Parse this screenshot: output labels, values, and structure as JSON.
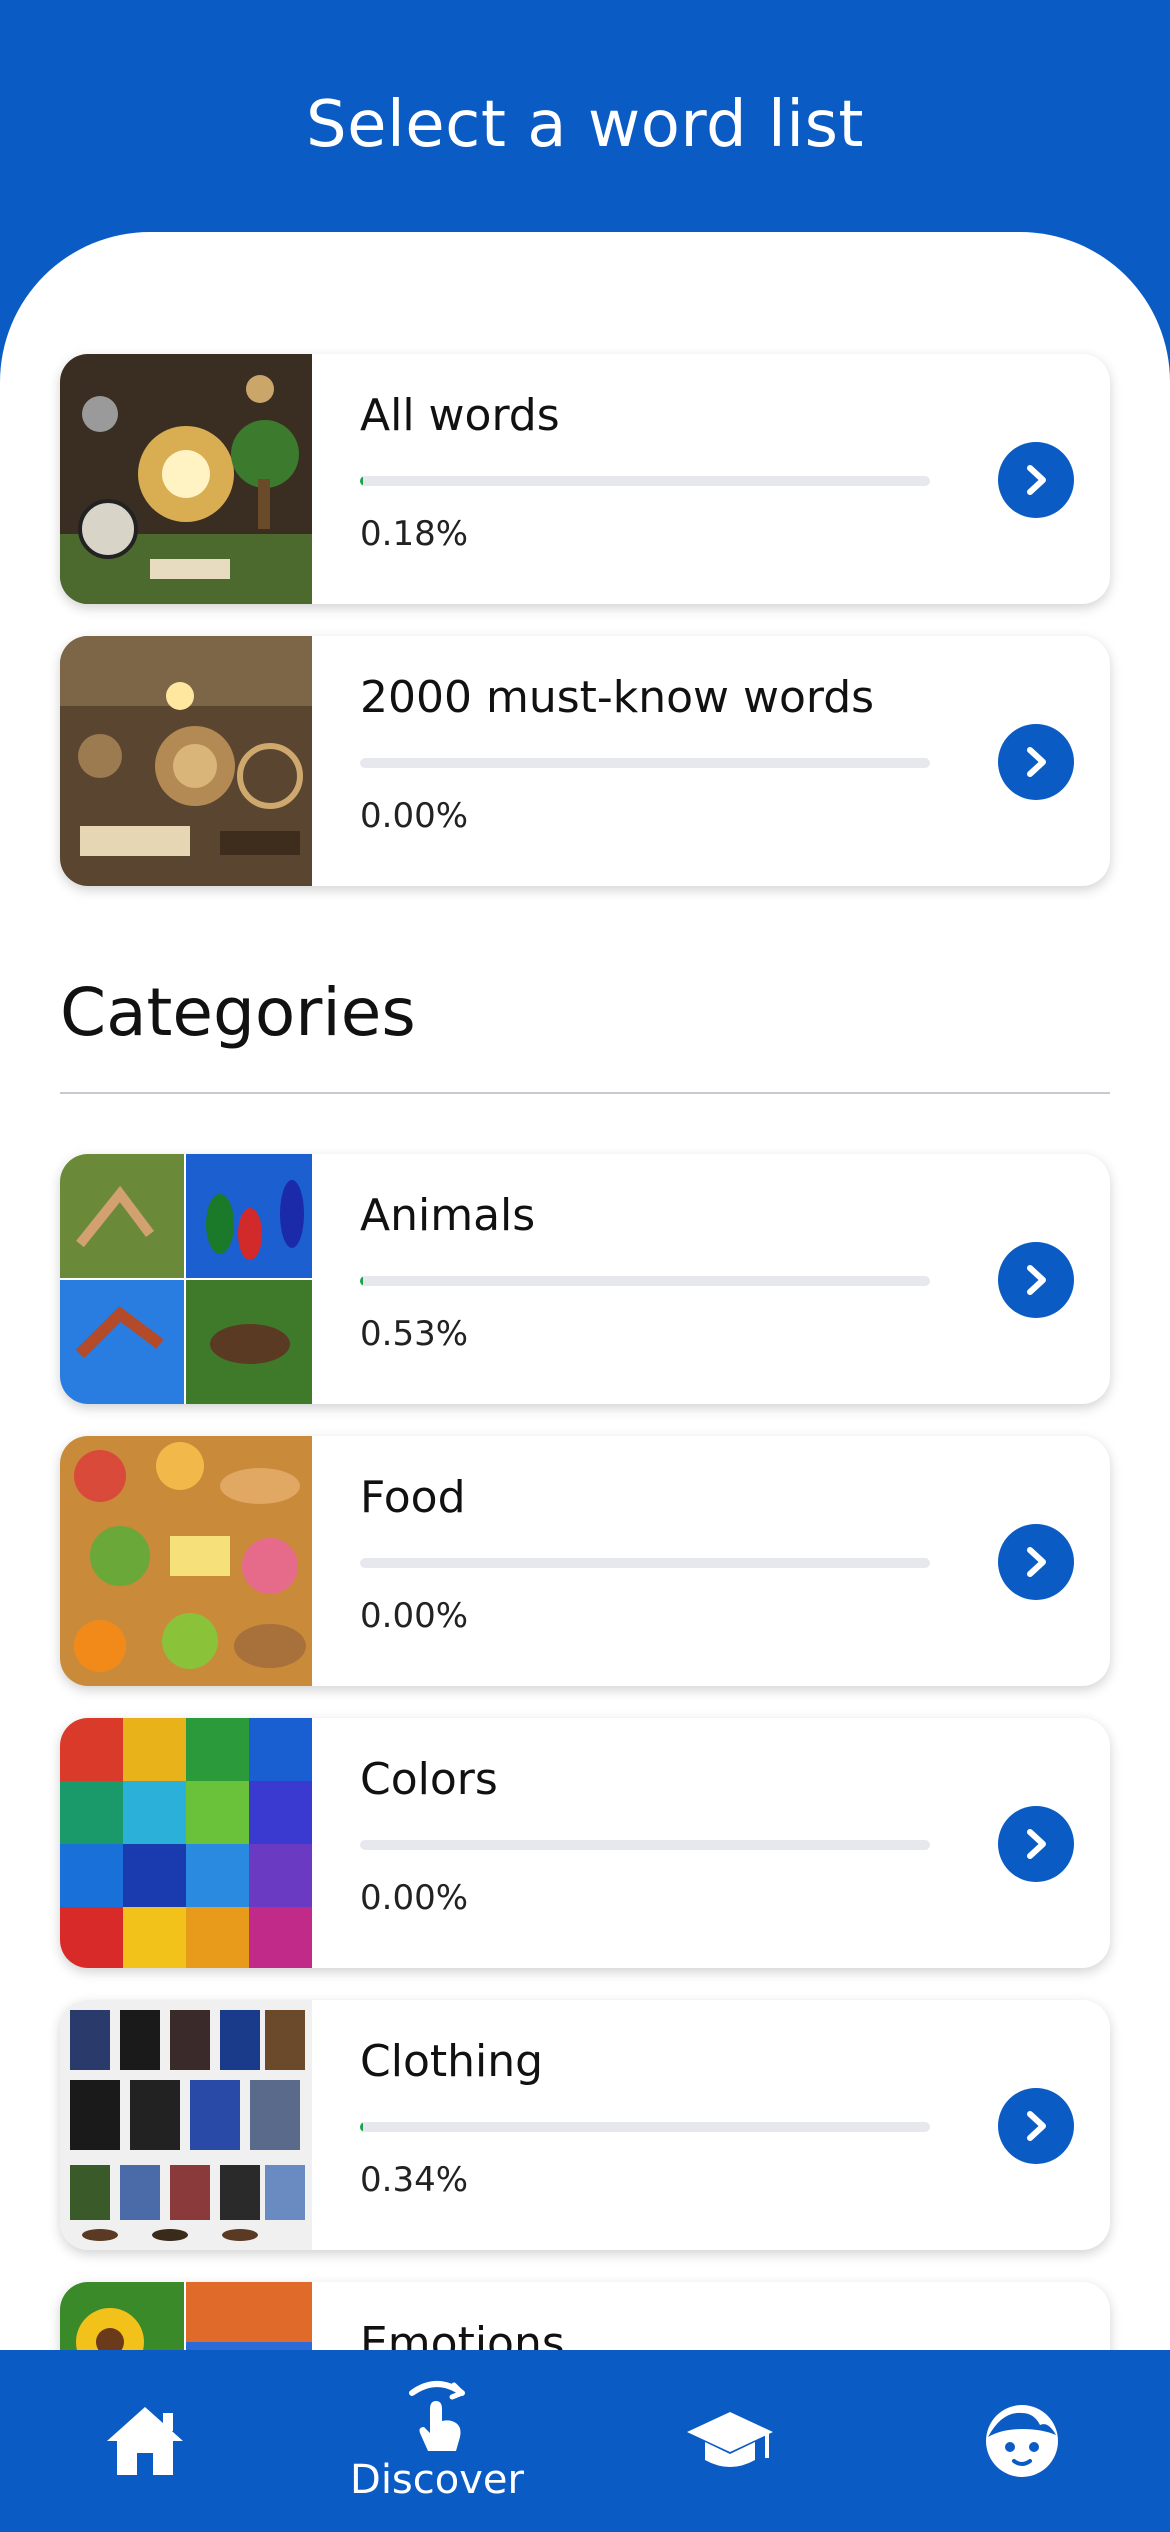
{
  "header": {
    "title": "Select a word list"
  },
  "featured": [
    {
      "title": "All words",
      "percent_label": "0.18%",
      "progress": 0.0018,
      "image_icon": "all-words-image"
    },
    {
      "title": "2000 must-know words",
      "percent_label": "0.00%",
      "progress": 0.0,
      "image_icon": "must-know-image"
    }
  ],
  "categories": {
    "title": "Categories",
    "items": [
      {
        "title": "Animals",
        "percent_label": "0.53%",
        "progress": 0.0053
      },
      {
        "title": "Food",
        "percent_label": "0.00%",
        "progress": 0.0
      },
      {
        "title": "Colors",
        "percent_label": "0.00%",
        "progress": 0.0
      },
      {
        "title": "Clothing",
        "percent_label": "0.34%",
        "progress": 0.0034
      },
      {
        "title": "Emotions",
        "percent_label": "",
        "progress": 0.0
      }
    ]
  },
  "bottom_nav": {
    "items": [
      {
        "icon": "home-icon",
        "label": ""
      },
      {
        "icon": "discover-icon",
        "label": "Discover"
      },
      {
        "icon": "graduation-cap-icon",
        "label": ""
      },
      {
        "icon": "profile-face-icon",
        "label": ""
      }
    ]
  },
  "colors": {
    "brand_blue": "#0a5bc4",
    "progress_green": "#19a54a",
    "track_gray": "#e6e8ee"
  }
}
